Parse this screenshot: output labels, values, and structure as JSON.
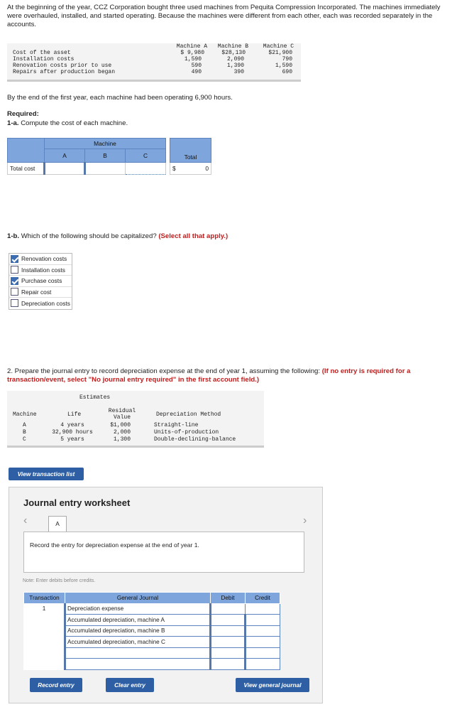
{
  "intro": "At the beginning of the year, CCZ Corporation bought three used machines from Pequita Compression Incorporated. The machines immediately were overhauled, installed, and started operating. Because the machines were different from each other, each was recorded separately in the accounts.",
  "asset_table": {
    "columns": [
      "Machine A",
      "Machine B",
      "Machine C"
    ],
    "rows": [
      {
        "label": "Cost of the asset",
        "values": [
          "$ 9,980",
          "$28,130",
          "$21,900"
        ]
      },
      {
        "label": "Installation costs",
        "values": [
          "1,590",
          "2,090",
          "790"
        ]
      },
      {
        "label": "Renovation costs prior to use",
        "values": [
          "590",
          "1,390",
          "1,590"
        ]
      },
      {
        "label": "Repairs after production began",
        "values": [
          "490",
          "390",
          "690"
        ]
      }
    ]
  },
  "hours_text": "By the end of the first year, each machine had been operating 6,900 hours.",
  "required_label": "Required:",
  "q1a": {
    "label": "1-a.",
    "text": " Compute the cost of each machine.",
    "group_header": "Machine",
    "columns": [
      "A",
      "B",
      "C"
    ],
    "total_header": "Total",
    "row_label": "Total cost",
    "values": [
      "",
      "",
      ""
    ],
    "currency": "$",
    "total_value": "0"
  },
  "q1b": {
    "label": "1-b.",
    "text": " Which of the following should be capitalized? ",
    "instruction": "(Select all that apply.)",
    "options": [
      {
        "label": "Renovation costs",
        "checked": true
      },
      {
        "label": "Installation costs",
        "checked": false
      },
      {
        "label": "Purchase costs",
        "checked": true
      },
      {
        "label": "Repair cost",
        "checked": false
      },
      {
        "label": "Depreciation costs",
        "checked": false
      }
    ]
  },
  "q2": {
    "text": "2. Prepare the journal entry to record depreciation expense at the end of year 1, assuming the following: ",
    "instruction": "(If no entry is required for a transaction/event, select \"No journal entry required\" in the first account field.)"
  },
  "estimates": {
    "group_header": "Estimates",
    "headers": {
      "machine": "Machine",
      "life": "Life",
      "residual_1": "Residual",
      "residual_2": "Value",
      "method": "Depreciation Method"
    },
    "rows": [
      {
        "machine": "A",
        "life": "4 years",
        "residual": "$1,000",
        "method": "Straight-line"
      },
      {
        "machine": "B",
        "life": "32,900 hours",
        "residual": "2,000",
        "method": "Units-of-production"
      },
      {
        "machine": "C",
        "life": "5 years",
        "residual": "1,300",
        "method": "Double-declining-balance"
      }
    ]
  },
  "view_transaction_list": "View transaction list",
  "worksheet": {
    "title": "Journal entry worksheet",
    "tab": "A",
    "prompt": "Record the entry for depreciation expense at the end of year 1.",
    "note": "Note: Enter debits before credits.",
    "headers": {
      "transaction": "Transaction",
      "journal": "General Journal",
      "debit": "Debit",
      "credit": "Credit"
    },
    "rows": [
      {
        "transaction": "1",
        "account": "Depreciation expense",
        "debit": "",
        "credit": ""
      },
      {
        "transaction": "",
        "account": "Accumulated depreciation, machine A",
        "debit": "",
        "credit": ""
      },
      {
        "transaction": "",
        "account": "Accumulated depreciation, machine B",
        "debit": "",
        "credit": ""
      },
      {
        "transaction": "",
        "account": "Accumulated depreciation, machine C",
        "debit": "",
        "credit": ""
      },
      {
        "transaction": "",
        "account": "",
        "debit": "",
        "credit": ""
      },
      {
        "transaction": "",
        "account": "",
        "debit": "",
        "credit": ""
      }
    ],
    "buttons": {
      "record": "Record entry",
      "clear": "Clear entry",
      "view_journal": "View general journal"
    },
    "prev_icon": "‹",
    "next_icon": "›"
  }
}
